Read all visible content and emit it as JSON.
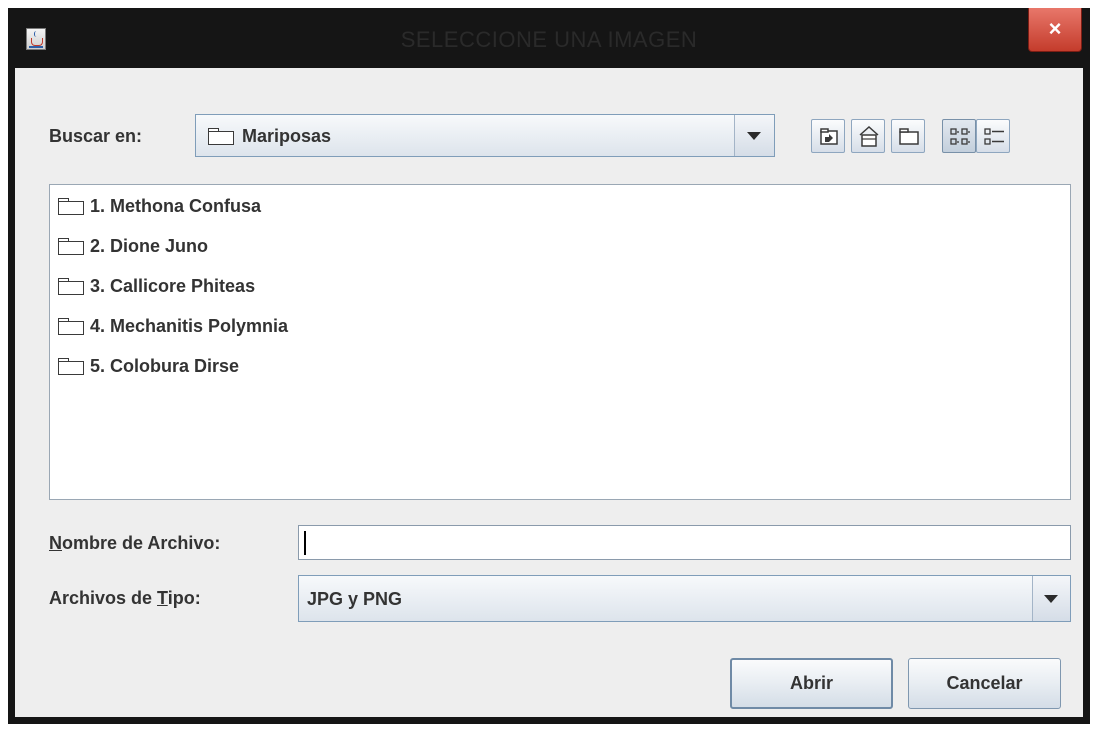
{
  "window": {
    "title": "SELECCIONE UNA IMAGEN",
    "close_label": "×"
  },
  "look_in": {
    "label": "Buscar en:",
    "selected": "Mariposas"
  },
  "toolbar": {
    "icons": [
      "up-one-level-icon",
      "home-icon",
      "new-folder-icon",
      "list-view-icon",
      "details-view-icon"
    ],
    "active_view": "list-view-icon"
  },
  "files": [
    {
      "name": "1. Methona Confusa",
      "icon": "folder-icon"
    },
    {
      "name": "2. Dione Juno",
      "icon": "folder-icon"
    },
    {
      "name": "3. Callicore Phiteas",
      "icon": "folder-icon"
    },
    {
      "name": "4. Mechanitis Polymnia",
      "icon": "folder-icon"
    },
    {
      "name": "5. Colobura Dirse",
      "icon": "folder-icon"
    }
  ],
  "file_name": {
    "label_mnemonic": "N",
    "label_rest": "ombre de Archivo:",
    "value": ""
  },
  "file_type": {
    "label_before": "Archivos de ",
    "label_mnemonic": "T",
    "label_after": "ipo:",
    "selected": "JPG y PNG"
  },
  "buttons": {
    "open": "Abrir",
    "cancel": "Cancelar"
  },
  "colors": {
    "titlebar": "#151515",
    "close_button": "#c43c2c",
    "dialog_background": "#eeeeee"
  }
}
